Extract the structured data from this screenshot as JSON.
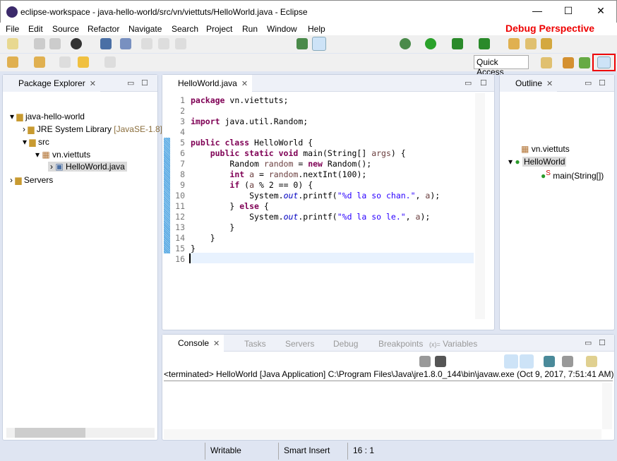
{
  "window": {
    "title": "eclipse-workspace - java-hello-world/src/vn/viettuts/HelloWorld.java - Eclipse",
    "minimize": "—",
    "maximize": "☐",
    "close": "✕"
  },
  "menu": [
    "File",
    "Edit",
    "Source",
    "Refactor",
    "Navigate",
    "Search",
    "Project",
    "Run",
    "Window",
    "Help"
  ],
  "annotation": {
    "label": "Debug Perspective",
    "color": "#ff0000"
  },
  "toolbar": {
    "quick_access": "Quick Access"
  },
  "package_explorer": {
    "title": "Package Explorer",
    "items": [
      {
        "label": "java-hello-world",
        "depth": 0,
        "arrow": "▼"
      },
      {
        "label": "JRE System Library",
        "suffix": "[JavaSE-1.8]",
        "depth": 1,
        "arrow": "›"
      },
      {
        "label": "src",
        "depth": 1,
        "arrow": "▼"
      },
      {
        "label": "vn.viettuts",
        "depth": 2,
        "arrow": "▼"
      },
      {
        "label": "HelloWorld.java",
        "depth": 3,
        "arrow": "›",
        "selected": true
      },
      {
        "label": "Servers",
        "depth": 0,
        "arrow": "›"
      }
    ]
  },
  "editor": {
    "tab": "HelloWorld.java",
    "cursor_line": 16,
    "lines": [
      "1",
      "2",
      "3",
      "4",
      "5",
      "6",
      "7",
      "8",
      "9",
      "10",
      "11",
      "12",
      "13",
      "14",
      "15",
      "16"
    ]
  },
  "outline": {
    "title": "Outline",
    "items": [
      {
        "label": "vn.viettuts"
      },
      {
        "label": "HelloWorld"
      },
      {
        "label": "main(String[])"
      }
    ]
  },
  "console": {
    "tabs": [
      "Console",
      "Tasks",
      "Servers",
      "Debug",
      "Breakpoints",
      "Variables"
    ],
    "variables_prefix": "(x)=",
    "status": "<terminated> HelloWorld [Java Application] C:\\Program Files\\Java\\jre1.8.0_144\\bin\\javaw.exe (Oct 9, 2017, 7:51:41 AM)"
  },
  "statusbar": {
    "writable": "Writable",
    "insert_mode": "Smart Insert",
    "position": "16 : 1"
  }
}
